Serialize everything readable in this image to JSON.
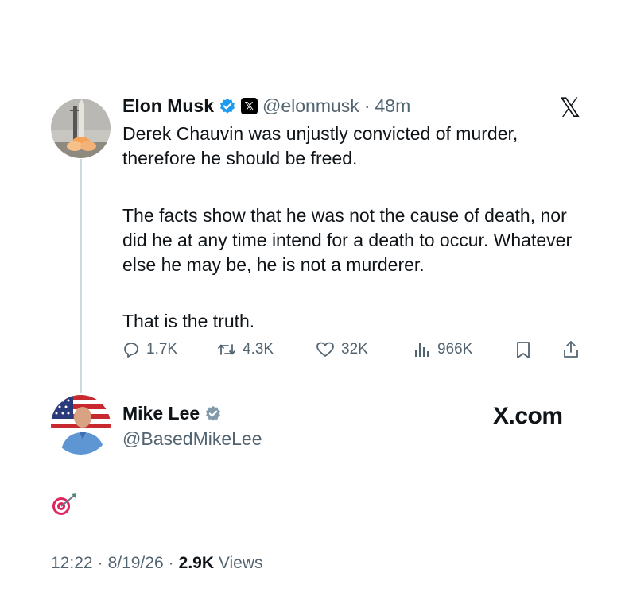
{
  "tweet1": {
    "name": "Elon Musk",
    "handle": "@elonmusk",
    "separator": "·",
    "time": "48m",
    "paragraph1": "Derek Chauvin was unjustly convicted of murder, therefore he should be freed.",
    "paragraph2": "The facts show that he was not the cause of death, nor did he at any time intend for a death to occur. Whatever else he may be, he is not a murderer.",
    "paragraph3": "That is the truth.",
    "actions": {
      "replies": "1.7K",
      "reposts": "4.3K",
      "likes": "32K",
      "views": "966K"
    },
    "avatar_icon": "rocket-launch-avatar",
    "brand_icon": "x-logo-icon"
  },
  "tweet2": {
    "name": "Mike Lee",
    "handle": "@BasedMikeLee",
    "brand_text": "X.com",
    "body_icon": "target-icon",
    "avatar_icon": "person-flag-avatar"
  },
  "footer": {
    "time": "12:22",
    "sep1": "·",
    "date": "8/19/26",
    "sep2": "·",
    "views_count": "2.9K",
    "views_label": "Views"
  },
  "colors": {
    "verified_blue": "#1d9bf0",
    "verified_gray": "#829aab",
    "muted_text": "#536471",
    "thread_line": "#cfd9de"
  }
}
